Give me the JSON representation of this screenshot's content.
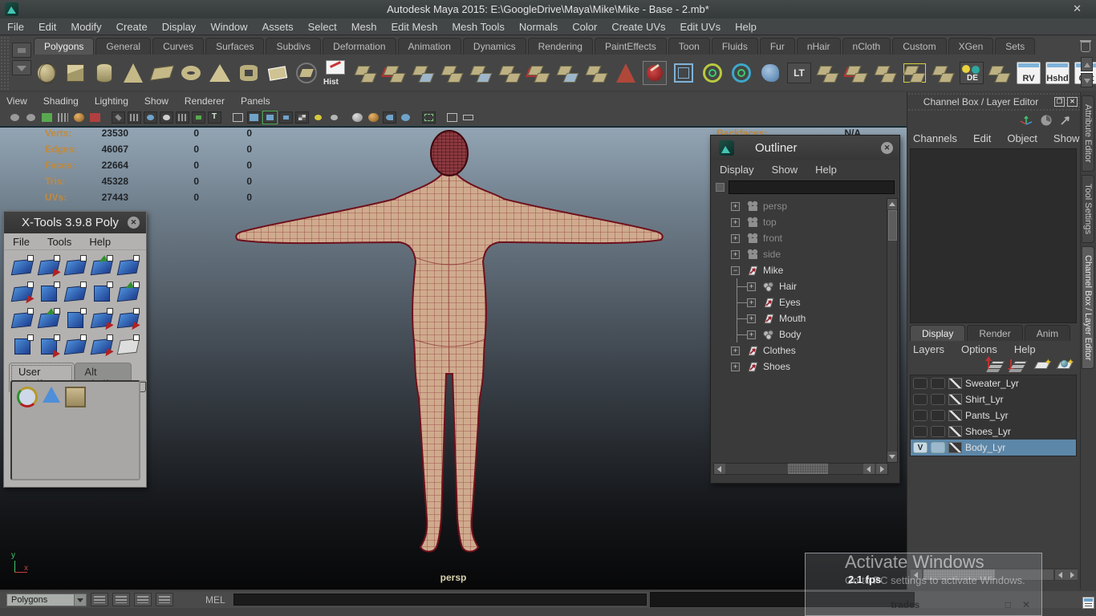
{
  "window": {
    "title": "Autodesk Maya 2015: E:\\GoogleDrive\\Maya\\Mike\\Mike - Base - 2.mb*",
    "close_glyph": "✕"
  },
  "menubar": {
    "items": [
      "File",
      "Edit",
      "Modify",
      "Create",
      "Display",
      "Window",
      "Assets",
      "Select",
      "Mesh",
      "Edit Mesh",
      "Mesh Tools",
      "Normals",
      "Color",
      "Create UVs",
      "Edit UVs",
      "Help"
    ]
  },
  "shelf": {
    "tabs": [
      "Polygons",
      "General",
      "Curves",
      "Surfaces",
      "Subdivs",
      "Deformation",
      "Animation",
      "Dynamics",
      "Rendering",
      "PaintEffects",
      "Toon",
      "Fluids",
      "Fur",
      "nHair",
      "nCloth",
      "Custom",
      "XGen",
      "Sets"
    ],
    "active_tab": "Polygons",
    "hist_label": "Hist",
    "lt_label": "LT",
    "de_label": "DE",
    "window_buttons": [
      "RV",
      "Hshd",
      "Out"
    ],
    "icon_names": [
      "poly-sphere",
      "poly-cube",
      "poly-cylinder",
      "poly-cone",
      "poly-plane",
      "poly-torus",
      "poly-pyramid",
      "poly-pipe",
      "quad-draw",
      "sculpt-mesh",
      "history-toggle",
      "combine",
      "separate",
      "extract",
      "booleans",
      "bridge",
      "append-polygon",
      "split-mesh",
      "merge-vertices",
      "extrude",
      "smooth",
      "sculpt-tool",
      "lattice",
      "crease-set",
      "crease-ring",
      "soft-modification",
      "lt-mode",
      "insert-edge-loop",
      "offset-edge-loop",
      "slide-edge",
      "multi-cut",
      "connect",
      "de-lighting",
      "edge-flow",
      "render-view",
      "hypershade",
      "outliner-window"
    ]
  },
  "viewport": {
    "menu": [
      "View",
      "Shading",
      "Lighting",
      "Show",
      "Renderer",
      "Panels"
    ],
    "hud": {
      "rows": [
        {
          "label": "Verts:",
          "v1": "23530",
          "v2": "0",
          "v3": "0"
        },
        {
          "label": "Edges:",
          "v1": "46067",
          "v2": "0",
          "v3": "0"
        },
        {
          "label": "Faces:",
          "v1": "22664",
          "v2": "0",
          "v3": "0"
        },
        {
          "label": "Tris:",
          "v1": "45328",
          "v2": "0",
          "v3": "0"
        },
        {
          "label": "UVs:",
          "v1": "27443",
          "v2": "0",
          "v3": "0"
        }
      ],
      "backfaces_label": "Backfaces:",
      "backfaces_value": "N/A"
    },
    "camera_label": "persp",
    "fps": "2.1 fps",
    "accent_colors": {
      "wireframe": "#7e1820",
      "skin": "#cfab8e",
      "bg_top": "#93a5b4",
      "bg_bottom": "#070708"
    }
  },
  "xtools": {
    "title": "X-Tools 3.9.8 Poly",
    "close_glyph": "✕",
    "menu": [
      "File",
      "Tools",
      "Help"
    ],
    "tabs": [
      "User Shelf",
      "Alt Shelf"
    ],
    "active_tab": "User Shelf",
    "shelf_icon_names": [
      "rotate-tool",
      "cone-bend-tool",
      "crate-tool"
    ]
  },
  "outliner": {
    "title": "Outliner",
    "close_glyph": "✕",
    "menu": [
      "Display",
      "Show",
      "Help"
    ],
    "search_value": "",
    "items": [
      {
        "label": "persp",
        "icon": "camera",
        "muted": true,
        "depth": 0,
        "expander": "+"
      },
      {
        "label": "top",
        "icon": "camera",
        "muted": true,
        "depth": 0,
        "expander": "+"
      },
      {
        "label": "front",
        "icon": "camera",
        "muted": true,
        "depth": 0,
        "expander": "+"
      },
      {
        "label": "side",
        "icon": "camera",
        "muted": true,
        "depth": 0,
        "expander": "+"
      },
      {
        "label": "Mike",
        "icon": "transform",
        "muted": false,
        "depth": 0,
        "expander": "−"
      },
      {
        "label": "Hair",
        "icon": "mesh",
        "muted": false,
        "depth": 1,
        "expander": "+"
      },
      {
        "label": "Eyes",
        "icon": "transform",
        "muted": false,
        "depth": 1,
        "expander": "+"
      },
      {
        "label": "Mouth",
        "icon": "transform",
        "muted": false,
        "depth": 1,
        "expander": "+"
      },
      {
        "label": "Body",
        "icon": "mesh",
        "muted": false,
        "depth": 1,
        "expander": "+"
      },
      {
        "label": "Clothes",
        "icon": "transform",
        "muted": false,
        "depth": 0,
        "expander": "+"
      },
      {
        "label": "Shoes",
        "icon": "transform",
        "muted": false,
        "depth": 0,
        "expander": "+"
      }
    ]
  },
  "channelbox": {
    "panel_title": "Channel Box / Layer Editor",
    "menu": [
      "Channels",
      "Edit",
      "Object",
      "Show"
    ],
    "side_tabs": [
      "Attribute Editor",
      "Tool Settings",
      "Channel Box / Layer Editor"
    ],
    "active_side_tab": "Channel Box / Layer Editor"
  },
  "layers": {
    "tabs": [
      "Display",
      "Render",
      "Anim"
    ],
    "active_tab": "Display",
    "menu": [
      "Layers",
      "Options",
      "Help"
    ],
    "toolbar_icon_names": [
      "move-layer-up",
      "move-layer-down",
      "create-empty-layer",
      "create-layer-assign-selected"
    ],
    "items": [
      {
        "name": "Sweater_Lyr",
        "v": "",
        "selected": false
      },
      {
        "name": "Shirt_Lyr",
        "v": "",
        "selected": false
      },
      {
        "name": "Pants_Lyr",
        "v": "",
        "selected": false
      },
      {
        "name": "Shoes_Lyr",
        "v": "",
        "selected": false
      },
      {
        "name": "Body_Lyr",
        "v": "V",
        "selected": true
      }
    ],
    "selection_color": "#5d87a8"
  },
  "statusline": {
    "mode": "Polygons",
    "mel_label": "MEL",
    "command_value": ""
  },
  "watermark": {
    "line1": "Activate Windows",
    "line2": "Go to PC settings to activate Windows."
  },
  "overlay": {
    "title": "trades",
    "restore_glyph": "□",
    "close_glyph": "✕"
  }
}
